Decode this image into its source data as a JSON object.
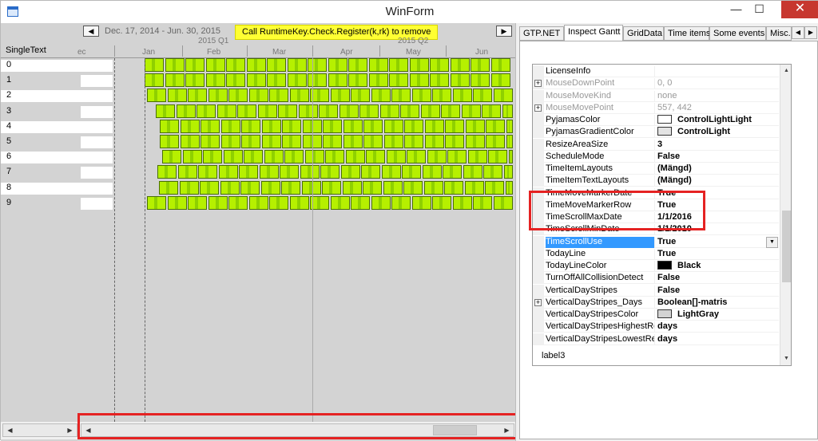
{
  "window": {
    "title": "WinForm",
    "minimize": "—",
    "maximize": "☐",
    "close": "✕"
  },
  "gantt": {
    "nav_prev": "◀",
    "nav_next": "▶",
    "date_range": "Dec. 17, 2014 - Jun. 30, 2015",
    "license_banner": "Call RuntimeKey.Check.Register(k,rk) to remove",
    "quarters": [
      "2015 Q1",
      "2015 Q2"
    ],
    "column_header": "SingleText",
    "months": [
      "ec",
      "Jan",
      "Feb",
      "Mar",
      "Apr",
      "May",
      "Jun"
    ],
    "rows": [
      "0",
      "1",
      "2",
      "3",
      "4",
      "5",
      "6",
      "7",
      "8",
      "9"
    ],
    "bar_color": "#b6f000"
  },
  "tabs": [
    "GTP.NET",
    "Inspect Gantt",
    "GridData",
    "Time items",
    "Some events",
    "Misc."
  ],
  "tab_active": "Inspect Gantt",
  "tab_scroll_left": "◀",
  "tab_scroll_right": "▶",
  "properties": [
    {
      "name": "LicenseInfo",
      "value": "",
      "expand": false,
      "grey": false,
      "bold": false
    },
    {
      "name": "MouseDownPoint",
      "value": "0, 0",
      "expand": true,
      "grey": true,
      "bold": false
    },
    {
      "name": "MouseMoveKind",
      "value": "none",
      "expand": false,
      "grey": true,
      "bold": false
    },
    {
      "name": "MouseMovePoint",
      "value": "557, 442",
      "expand": true,
      "grey": true,
      "bold": false
    },
    {
      "name": "PyjamasColor",
      "value": "ControlLightLight",
      "swatch": "#ffffff",
      "expand": false,
      "grey": false,
      "bold": true
    },
    {
      "name": "PyjamasGradientColor",
      "value": "ControlLight",
      "swatch": "#e3e3e3",
      "expand": false,
      "grey": false,
      "bold": true
    },
    {
      "name": "ResizeAreaSize",
      "value": "3",
      "expand": false,
      "grey": false,
      "bold": true
    },
    {
      "name": "ScheduleMode",
      "value": "False",
      "expand": false,
      "grey": false,
      "bold": true
    },
    {
      "name": "TimeItemLayouts",
      "value": "(Mängd)",
      "expand": false,
      "grey": false,
      "bold": true
    },
    {
      "name": "TimeItemTextLayouts",
      "value": "(Mängd)",
      "expand": false,
      "grey": false,
      "bold": true
    },
    {
      "name": "TimeMoveMarkerDate",
      "value": "True",
      "expand": false,
      "grey": false,
      "bold": true
    },
    {
      "name": "TimeMoveMarkerRow",
      "value": "True",
      "expand": false,
      "grey": false,
      "bold": true
    },
    {
      "name": "TimeScrollMaxDate",
      "value": "1/1/2016",
      "expand": false,
      "grey": false,
      "bold": true
    },
    {
      "name": "TimeScrollMinDate",
      "value": "1/1/2010",
      "expand": false,
      "grey": false,
      "bold": true
    },
    {
      "name": "TimeScrollUse",
      "value": "True",
      "expand": false,
      "grey": false,
      "bold": true,
      "selected": true
    },
    {
      "name": "TodayLine",
      "value": "True",
      "expand": false,
      "grey": false,
      "bold": true
    },
    {
      "name": "TodayLineColor",
      "value": "Black",
      "swatch": "#000000",
      "expand": false,
      "grey": false,
      "bold": true
    },
    {
      "name": "TurnOffAllCollisionDetect",
      "value": "False",
      "expand": false,
      "grey": false,
      "bold": true
    },
    {
      "name": "VerticalDayStripes",
      "value": "False",
      "expand": false,
      "grey": false,
      "bold": true
    },
    {
      "name": "VerticalDayStripes_Days",
      "value": "Boolean[]-matris",
      "expand": true,
      "grey": false,
      "bold": true
    },
    {
      "name": "VerticalDayStripesColor",
      "value": "LightGray",
      "swatch": "#d3d3d3",
      "expand": false,
      "grey": false,
      "bold": true
    },
    {
      "name": "VerticalDayStripesHighestRe",
      "value": "days",
      "expand": false,
      "grey": false,
      "bold": true
    },
    {
      "name": "VerticalDayStripesLowestRe",
      "value": "days",
      "expand": false,
      "grey": false,
      "bold": true
    }
  ],
  "label3": "label3",
  "dropdown_arrow": "▼",
  "highlight_color": "#e52222"
}
